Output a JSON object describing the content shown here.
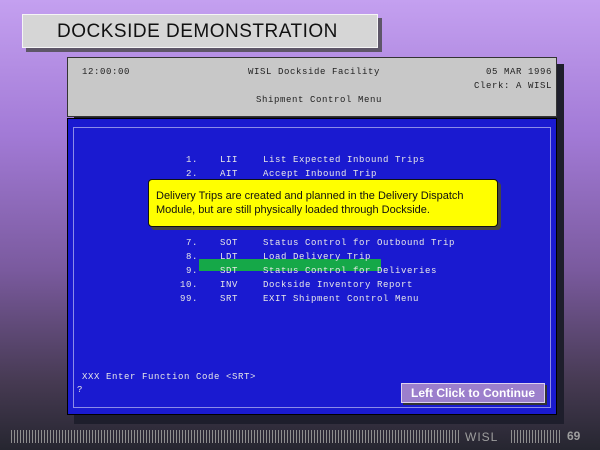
{
  "slide_title": "DOCKSIDE DEMONSTRATION",
  "terminal": {
    "time": "12:00:00",
    "facility": "WISL Dockside Facility",
    "date": "05 MAR 1996",
    "clerk": "Clerk: A WISL",
    "menu_title": "Shipment Control Menu"
  },
  "menu_items": [
    {
      "num": "1.",
      "code": "LII",
      "desc": "List Expected Inbound Trips"
    },
    {
      "num": "2.",
      "code": "AIT",
      "desc": "Accept Inbound Trip"
    },
    {
      "num": "7.",
      "code": "SOT",
      "desc": "Status Control for Outbound Trip"
    },
    {
      "num": "8.",
      "code": "LDT",
      "desc": "Load Delivery Trip"
    },
    {
      "num": "9.",
      "code": "SDT",
      "desc": "Status Control for Deliveries"
    },
    {
      "num": "10.",
      "code": "INV",
      "desc": "Dockside Inventory Report"
    },
    {
      "num": "99.",
      "code": "SRT",
      "desc": "EXIT Shipment Control Menu"
    }
  ],
  "prompt": "XXX Enter Function Code <SRT>",
  "cursor": "?",
  "callout": {
    "text": "Delivery Trips are created and planned in the Delivery Dispatch Module, but are still physically loaded through Dockside."
  },
  "continue_button": "Left Click to Continue",
  "footer": {
    "brand": "WISL",
    "page": "69"
  },
  "colors": {
    "terminal_blue": "#1a1ad0",
    "highlight_green": "#15a848",
    "callout_yellow": "#ffff00"
  }
}
